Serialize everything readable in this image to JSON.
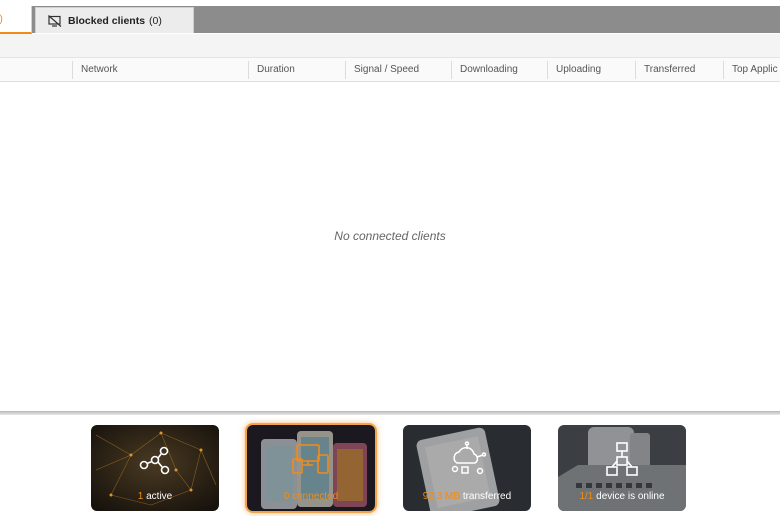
{
  "tabs": {
    "active_partial": "0)",
    "blocked": {
      "label": "Blocked clients",
      "count": "(0)"
    }
  },
  "columns": [
    "Network",
    "Duration",
    "Signal / Speed",
    "Downloading",
    "Uploading",
    "Transferred",
    "Top Applic"
  ],
  "empty_message": "No connected clients",
  "tiles": [
    {
      "value": "1",
      "text": "active",
      "icon": "network-share-icon"
    },
    {
      "value": "0",
      "text": "connected",
      "icon": "devices-icon"
    },
    {
      "value": "92.3 MB",
      "text": "transferred",
      "icon": "cloud-transfer-icon"
    },
    {
      "value": "1/1",
      "text": "device is online",
      "icon": "topology-icon"
    }
  ],
  "colors": {
    "accent": "#f08c18",
    "tab_bar": "#8c8c8c"
  }
}
